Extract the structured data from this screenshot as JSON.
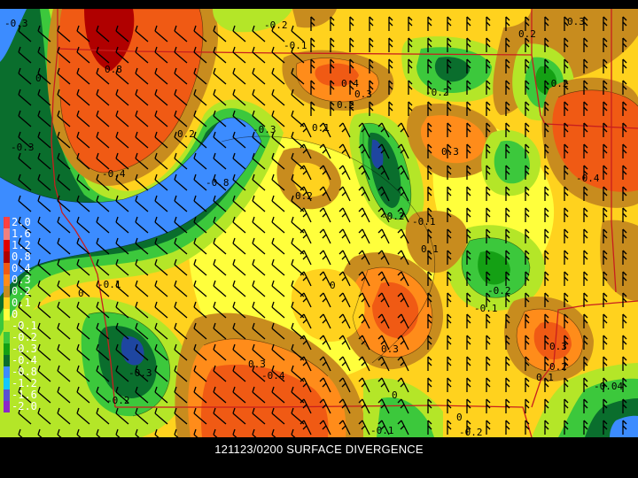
{
  "title": "121123/0200 SURFACE DIVERGENCE",
  "legend": [
    {
      "label": "2.0",
      "color": "#ff4040"
    },
    {
      "label": "1.6",
      "color": "#f08080"
    },
    {
      "label": "1.2",
      "color": "#e00000"
    },
    {
      "label": "0.8",
      "color": "#b00000"
    },
    {
      "label": "0.4",
      "color": "#f05a14"
    },
    {
      "label": "0.3",
      "color": "#ff8c1a"
    },
    {
      "label": "0.2",
      "color": "#c88c1e"
    },
    {
      "label": "0.1",
      "color": "#ffd21e"
    },
    {
      "label": "0",
      "color": "#ffff3c"
    },
    {
      "label": "-0.1",
      "color": "#b4e628"
    },
    {
      "label": "-0.2",
      "color": "#3cc83c"
    },
    {
      "label": "-0.3",
      "color": "#14a014"
    },
    {
      "label": "-0.4",
      "color": "#0a6e2d"
    },
    {
      "label": "-0.8",
      "color": "#3c8cff"
    },
    {
      "label": "-1.2",
      "color": "#14c8ff"
    },
    {
      "label": "-1.6",
      "color": "#5a50d2"
    },
    {
      "label": "-2.0",
      "color": "#8c28c8"
    }
  ],
  "contour_labels": [
    "-0.3",
    "-0.2",
    "0",
    "0.1",
    "0.2",
    "0.3",
    "0.4",
    "0.8",
    "-0.1",
    "-0.4",
    "-0.8",
    "-0.04"
  ],
  "fields": {
    "base": "#ffff3c",
    "brown": "#c88c1e",
    "orange": "#ff8c1a",
    "red_orange": "#f05a14",
    "dark_red": "#b00000",
    "light_green": "#b4e628",
    "green": "#3cc83c",
    "mid_green": "#14a014",
    "dark_green": "#0a6e2d",
    "blue": "#3c8cff",
    "navy": "#1e46a0",
    "boundary": "#c81e1e"
  }
}
